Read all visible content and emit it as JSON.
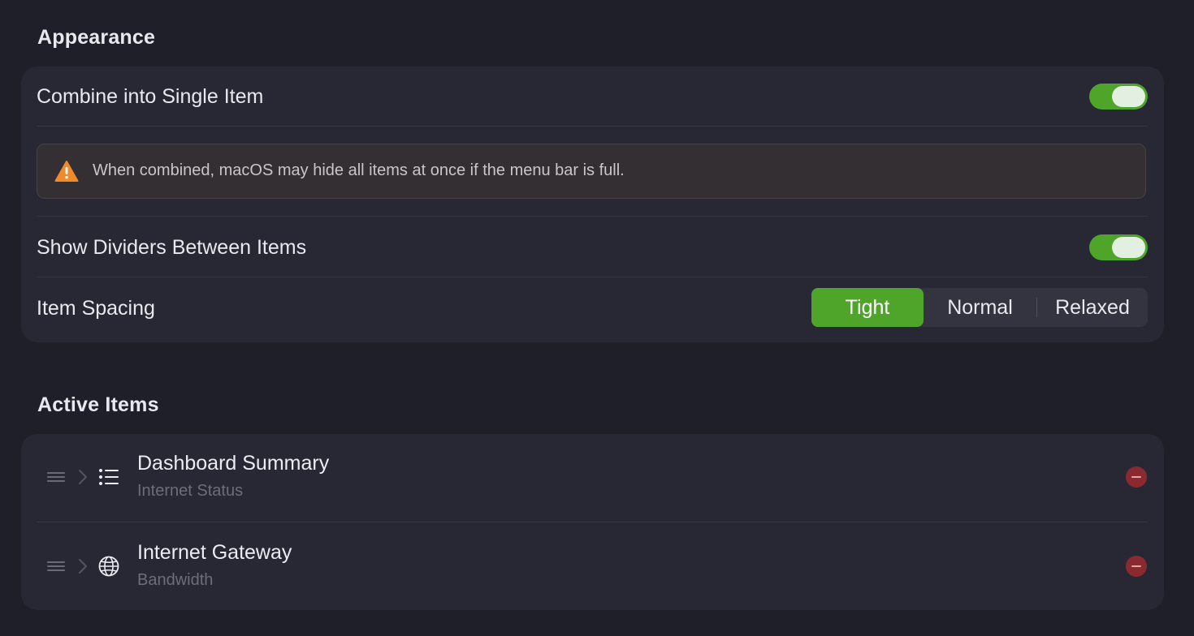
{
  "appearance": {
    "title": "Appearance",
    "combine": {
      "label": "Combine into Single Item",
      "enabled": true
    },
    "warning": {
      "icon": "warning-triangle-icon",
      "text": "When combined, macOS may hide all items at once if the menu bar is full."
    },
    "dividers": {
      "label": "Show Dividers Between Items",
      "enabled": true
    },
    "spacing": {
      "label": "Item Spacing",
      "options": [
        "Tight",
        "Normal",
        "Relaxed"
      ],
      "selected": "Tight"
    }
  },
  "active_items": {
    "title": "Active Items",
    "items": [
      {
        "title": "Dashboard Summary",
        "subtitle": "Internet Status",
        "icon": "list-icon"
      },
      {
        "title": "Internet Gateway",
        "subtitle": "Bandwidth",
        "icon": "globe-icon"
      }
    ]
  },
  "colors": {
    "accent_green": "#4ea52a",
    "warning_orange": "#f08b2d",
    "remove_red": "#8a2a30",
    "background": "#1f1f29",
    "card": "#282835"
  }
}
